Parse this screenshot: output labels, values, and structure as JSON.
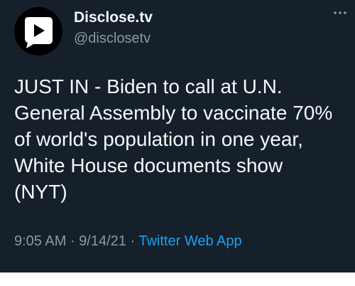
{
  "account": {
    "display_name": "Disclose.tv",
    "handle": "@disclosetv",
    "avatar_icon": "disclose-tv-logo-icon"
  },
  "more_icon": "more-horizontal-icon",
  "tweet": {
    "text_lines": [
      "JUST IN - Biden to call at U.N.",
      "General Assembly to vaccinate 70%",
      "of world's population in one year,",
      "White House documents show",
      "(NYT)"
    ]
  },
  "meta": {
    "time": "9:05 AM",
    "separator": "·",
    "date": "9/14/21",
    "source": "Twitter Web App"
  },
  "colors": {
    "background": "#15202b",
    "text": "#f5f8fa",
    "secondary": "#8899a6",
    "link": "#1da1f2"
  }
}
